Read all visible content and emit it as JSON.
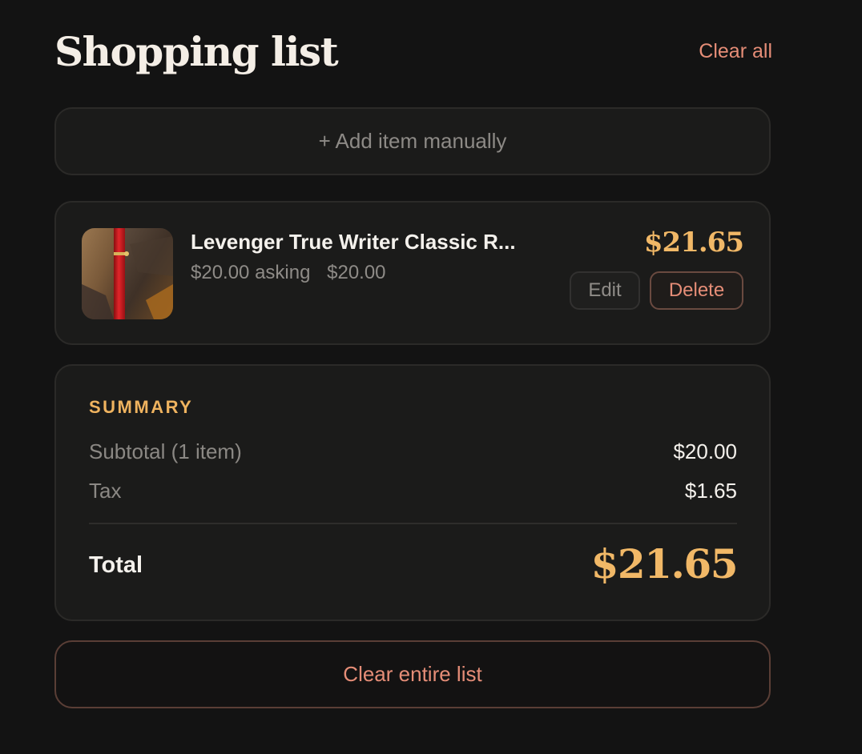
{
  "header": {
    "title": "Shopping list",
    "clear_all_label": "Clear all"
  },
  "add_item": {
    "label": "+ Add item manually"
  },
  "items": [
    {
      "name": "Levenger True Writer Classic R...",
      "asking_label": "$20.00 asking",
      "price_label": "$20.00",
      "total": "$21.65",
      "edit_label": "Edit",
      "delete_label": "Delete",
      "thumbnail_icon": "red-pen-photo"
    }
  ],
  "summary": {
    "heading": "SUMMARY",
    "subtotal_label": "Subtotal (1 item)",
    "subtotal_value": "$20.00",
    "tax_label": "Tax",
    "tax_value": "$1.65",
    "total_label": "Total",
    "total_value": "$21.65"
  },
  "footer": {
    "clear_list_label": "Clear entire list"
  },
  "colors": {
    "background": "#131313",
    "card": "#1b1b1a",
    "accent_gold": "#f1b867",
    "accent_coral": "#e58d77",
    "muted_text": "#8e8b87"
  }
}
